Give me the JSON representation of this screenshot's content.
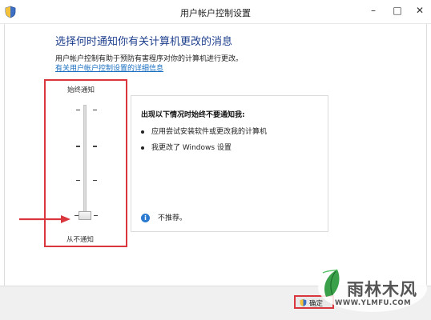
{
  "window": {
    "title": "用户帐户控制设置",
    "controls": {
      "minimize": "–",
      "maximize": "□",
      "close": "✕"
    }
  },
  "main": {
    "heading": "选择何时通知你有关计算机更改的消息",
    "description": "用户帐户控制有助于预防有害程序对你的计算机进行更改。",
    "learn_more_link": "有关用户帐户控制设置的详细信息"
  },
  "slider": {
    "top_label": "始终通知",
    "bottom_label": "从不通知",
    "levels": 4,
    "selected_level": 1
  },
  "info_panel": {
    "title": "出现以下情况时始终不要通知我:",
    "bullets": [
      "应用尝试安装软件或更改我的计算机",
      "我更改了 Windows 设置"
    ],
    "note_icon": "i",
    "note": "不推荐。"
  },
  "footer": {
    "ok_label": "确定"
  },
  "watermark": {
    "title": "雨林木风",
    "url": "WWW.YLMFU.COM"
  },
  "colors": {
    "heading": "#1e3f8c",
    "link": "#1a6fc0",
    "highlight": "#d9363e",
    "info": "#2d7bd0"
  },
  "icons": {
    "app": "uac-shield-icon",
    "arrow": "red-arrow-icon",
    "note": "info-icon"
  }
}
